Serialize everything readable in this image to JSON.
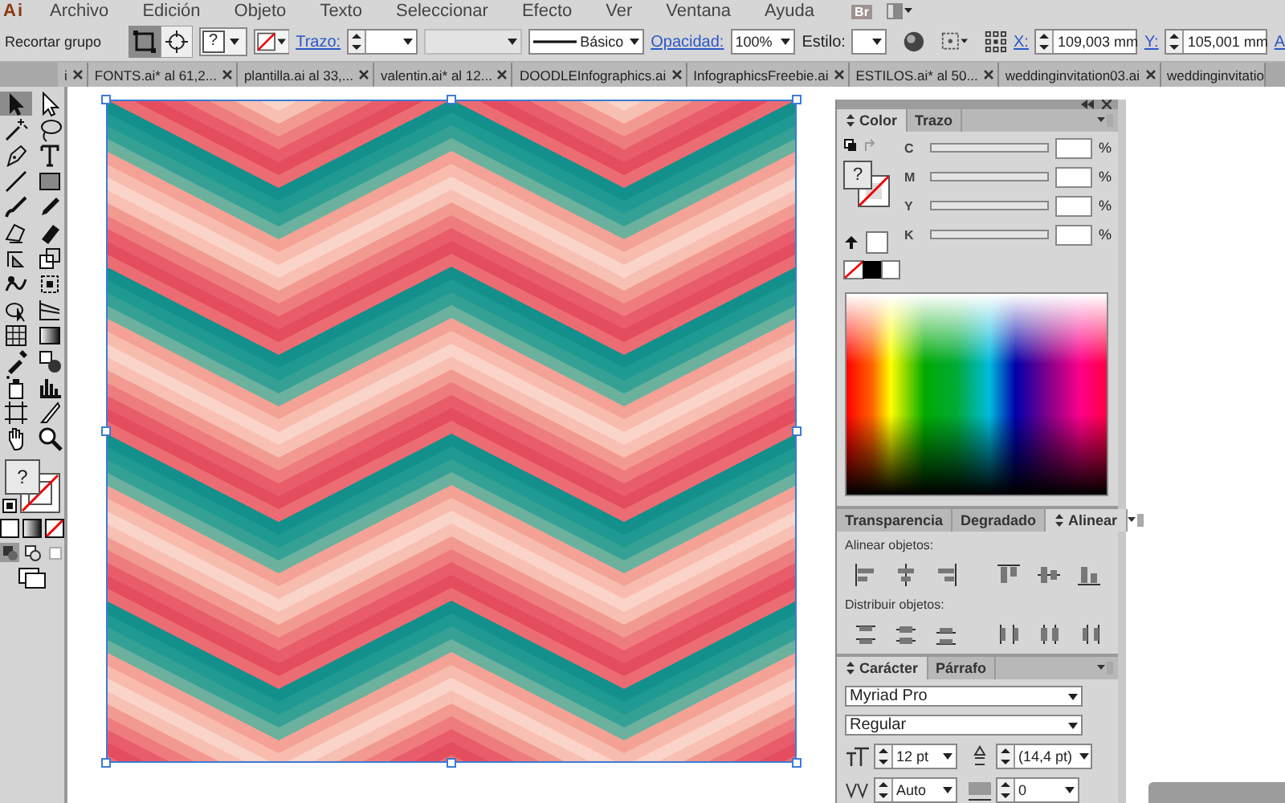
{
  "app": {
    "logo": "Ai",
    "bridge": "Br"
  },
  "menu": [
    "Archivo",
    "Edición",
    "Objeto",
    "Texto",
    "Seleccionar",
    "Efecto",
    "Ver",
    "Ventana",
    "Ayuda"
  ],
  "control_bar": {
    "selection_label": "Recortar grupo",
    "fill_swatch": "?",
    "stroke_label": "Trazo:",
    "stroke_style": "Básico",
    "opacity_label": "Opacidad:",
    "opacity": "100%",
    "style_label": "Estilo:",
    "x_label": "X:",
    "x": "109,003 mm",
    "y_label": "Y:",
    "y": "105,001 mm",
    "width_label": "A"
  },
  "document_tabs": [
    {
      "label": "i"
    },
    {
      "label": "FONTS.ai* al 61,2..."
    },
    {
      "label": "plantilla.ai al 33,..."
    },
    {
      "label": "valentin.ai* al 12..."
    },
    {
      "label": "DOODLEInfographics.ai"
    },
    {
      "label": "InfographicsFreebie.ai"
    },
    {
      "label": "ESTILOS.ai* al 50..."
    },
    {
      "label": "weddinginvitation03.ai"
    },
    {
      "label": "weddinginvitatio"
    }
  ],
  "tools": [
    {
      "kind": "selection",
      "selected": true
    },
    {
      "kind": "direct",
      "selected": false
    },
    {
      "kind": "wand",
      "selected": false
    },
    {
      "kind": "lasso",
      "selected": false
    },
    {
      "kind": "pen",
      "selected": false
    },
    {
      "kind": "type",
      "selected": false
    },
    {
      "kind": "line",
      "selected": false
    },
    {
      "kind": "rect",
      "selected": false
    },
    {
      "kind": "brush",
      "selected": false
    },
    {
      "kind": "pencil",
      "selected": false
    },
    {
      "kind": "blob",
      "selected": false
    },
    {
      "kind": "eraser",
      "selected": false
    },
    {
      "kind": "rotate",
      "selected": false
    },
    {
      "kind": "scale",
      "selected": false
    },
    {
      "kind": "warp",
      "selected": false
    },
    {
      "kind": "transform",
      "selected": false
    },
    {
      "kind": "builder",
      "selected": false
    },
    {
      "kind": "perspective",
      "selected": false
    },
    {
      "kind": "mesh",
      "selected": false
    },
    {
      "kind": "gradient",
      "selected": false
    },
    {
      "kind": "eyedropper",
      "selected": false
    },
    {
      "kind": "blend",
      "selected": false
    },
    {
      "kind": "sprayer",
      "selected": false
    },
    {
      "kind": "graph",
      "selected": false
    },
    {
      "kind": "artboard",
      "selected": false
    },
    {
      "kind": "slice",
      "selected": false
    },
    {
      "kind": "hand",
      "selected": false
    },
    {
      "kind": "zoom",
      "selected": false
    }
  ],
  "fill_stroke": {
    "fill": "?"
  },
  "color_panel": {
    "tabs": [
      {
        "label": "Color",
        "selected": true
      },
      {
        "label": "Trazo",
        "selected": false
      }
    ],
    "fill": "?",
    "channels": [
      {
        "name": "C",
        "unit": "%"
      },
      {
        "name": "M",
        "unit": "%"
      },
      {
        "name": "Y",
        "unit": "%"
      },
      {
        "name": "K",
        "unit": "%"
      }
    ]
  },
  "align_panel": {
    "tabs": [
      {
        "label": "Transparencia",
        "selected": false
      },
      {
        "label": "Degradado",
        "selected": false
      },
      {
        "label": "Alinear",
        "selected": true
      }
    ],
    "align_label": "Alinear objetos:",
    "distribute_label": "Distribuir objetos:"
  },
  "character_panel": {
    "tabs": [
      {
        "label": "Carácter",
        "selected": true
      },
      {
        "label": "Párrafo",
        "selected": false
      }
    ],
    "font": "Myriad Pro",
    "style": "Regular",
    "size": "12 pt",
    "leading": "(14,4 pt)",
    "kerning": "Auto",
    "tracking": "0"
  }
}
